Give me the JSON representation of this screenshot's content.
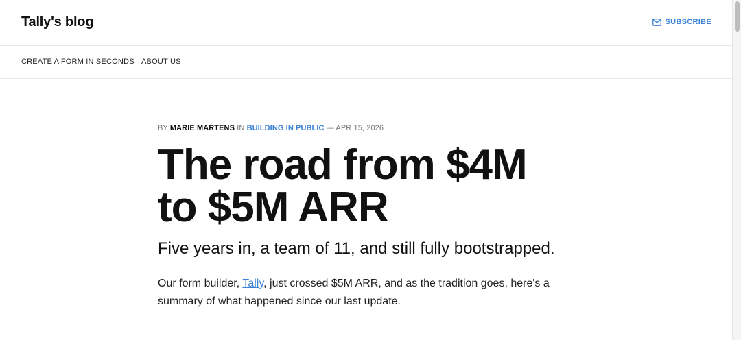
{
  "header": {
    "logo": "Tally's blog",
    "subscribe_label": "SUBSCRIBE",
    "subscribe_icon": "mail-icon"
  },
  "nav": {
    "items": [
      {
        "label": "CREATE A FORM IN SECONDS"
      },
      {
        "label": "ABOUT US"
      }
    ]
  },
  "article": {
    "meta": {
      "by": "BY",
      "author": "MARIE MARTENS",
      "in": "IN",
      "category": "BUILDING IN PUBLIC",
      "separator": "—",
      "date": "APR 15, 2026"
    },
    "title_line1": "The road from $4M",
    "title_line2": "to $5M ARR",
    "subtitle": "Five years in, a team of 11, and still fully bootstrapped.",
    "body": {
      "part1": "Our form builder, ",
      "link": "Tally",
      "part2": ", just crossed $5M ARR, and as the tradition goes, here's a summary of what happened since our last update."
    }
  },
  "colors": {
    "accent": "#3b82d6",
    "text": "#111111",
    "muted": "#777777",
    "border": "#e8e8e8"
  }
}
